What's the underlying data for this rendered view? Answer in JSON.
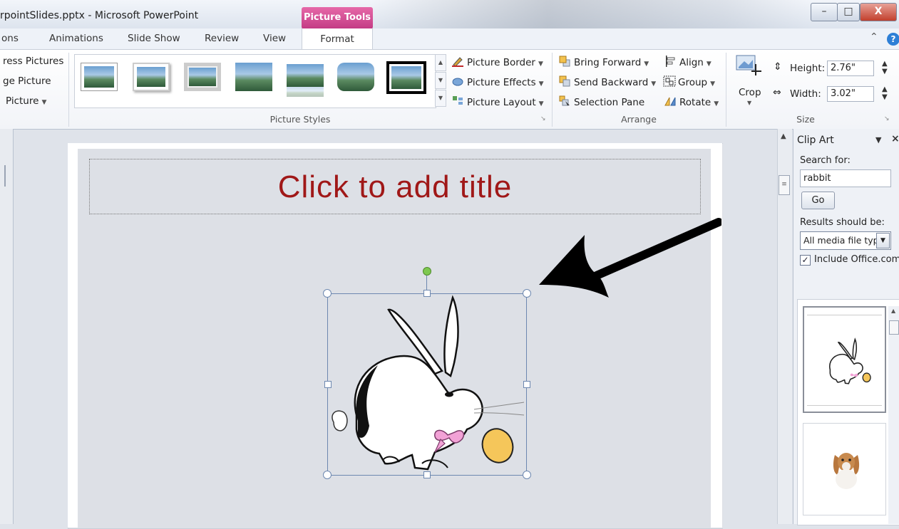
{
  "window": {
    "title": "rpointSlides.pptx - Microsoft PowerPoint",
    "contextual_tab": "Picture Tools",
    "minimize": "–",
    "maximize": "□",
    "close": "X"
  },
  "tabs": [
    {
      "label": "ons"
    },
    {
      "label": "Animations"
    },
    {
      "label": "Slide Show"
    },
    {
      "label": "Review"
    },
    {
      "label": "View"
    },
    {
      "label": "Format"
    }
  ],
  "help": {
    "collapse": "⌃",
    "help": "?"
  },
  "adjust": {
    "compress": "ress Pictures",
    "change": "ge Picture",
    "reset": "Picture"
  },
  "picture_styles": {
    "group_label": "Picture Styles",
    "border": "Picture Border",
    "effects": "Picture Effects",
    "layout": "Picture Layout"
  },
  "arrange": {
    "group_label": "Arrange",
    "bring_forward": "Bring Forward",
    "send_backward": "Send Backward",
    "selection_pane": "Selection Pane",
    "align": "Align",
    "group": "Group",
    "rotate": "Rotate"
  },
  "size": {
    "group_label": "Size",
    "crop": "Crop",
    "height_label": "Height:",
    "height_value": "2.76\"",
    "width_label": "Width:",
    "width_value": "3.02\""
  },
  "slide": {
    "title_placeholder": "Click to add title"
  },
  "clip_art": {
    "title": "Clip Art",
    "search_label": "Search for:",
    "search_value": "rabbit",
    "go": "Go",
    "results_label": "Results should be:",
    "media_type": "All media file typ",
    "include_label": "Include Office.com",
    "include_checked": true
  },
  "colors": {
    "accent_pink": "#c43c85",
    "title_red": "#a01818",
    "selection_blue": "#6d88b0",
    "rotate_green": "#7ec850"
  }
}
